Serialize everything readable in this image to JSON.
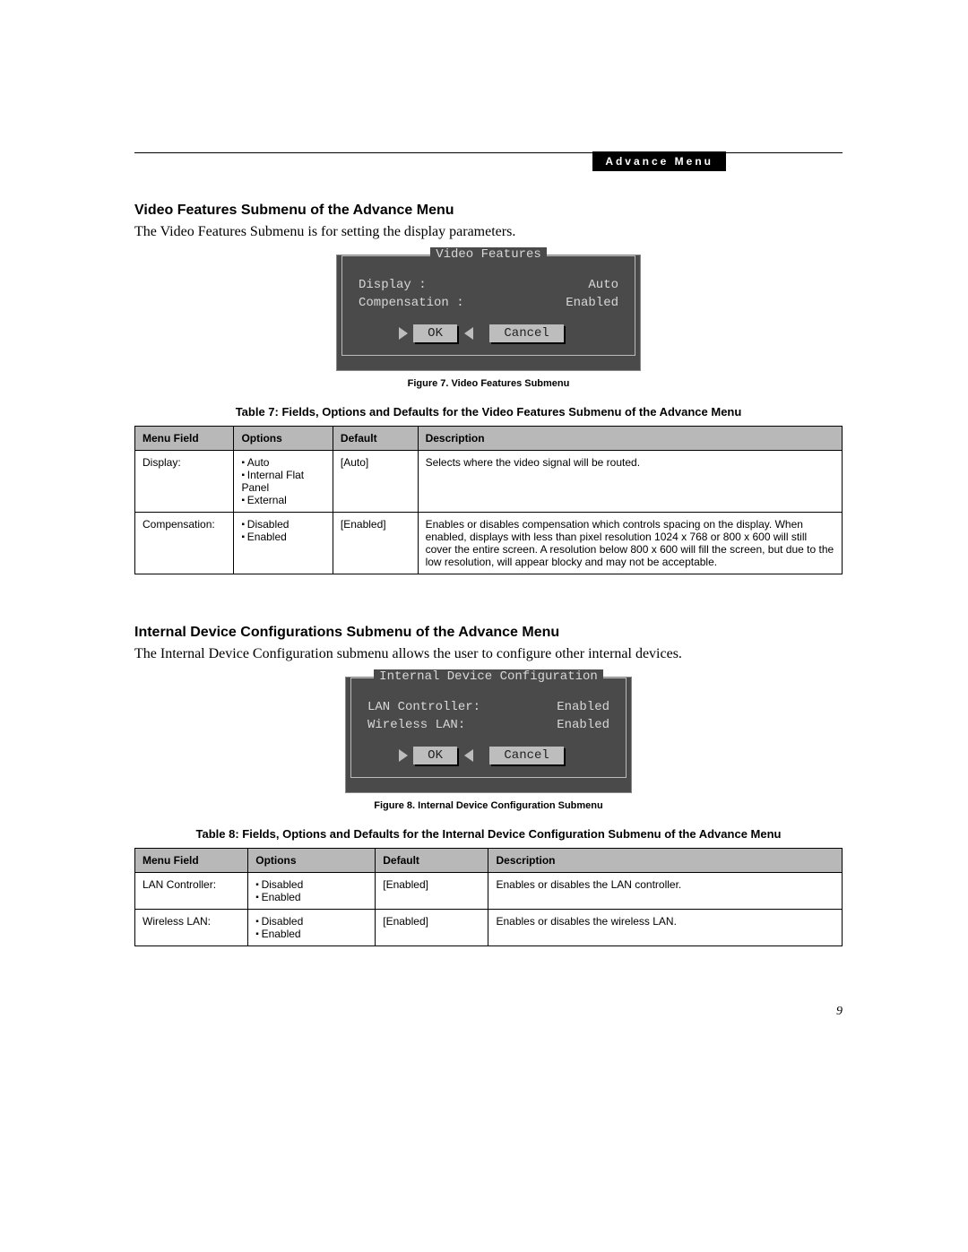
{
  "header": {
    "tag": "Advance Menu"
  },
  "page_number": "9",
  "section1": {
    "heading": "Video Features Submenu of the Advance Menu",
    "intro": "The Video Features Submenu is for setting the display parameters.",
    "panel": {
      "title": "Video Features",
      "rows": [
        {
          "label": "Display :",
          "value": "Auto"
        },
        {
          "label": "Compensation :",
          "value": "Enabled"
        }
      ],
      "buttons": {
        "ok": "OK",
        "cancel": "Cancel"
      }
    },
    "figure_caption": "Figure 7.  Video Features Submenu",
    "table_title": "Table 7: Fields, Options and Defaults for the Video Features Submenu of the Advance Menu",
    "columns": {
      "menu_field": "Menu Field",
      "options": "Options",
      "default": "Default",
      "description": "Description"
    },
    "rows": [
      {
        "menu_field": "Display:",
        "options": [
          "Auto",
          "Internal Flat Panel",
          "External"
        ],
        "default": "[Auto]",
        "description": "Selects where the video signal will be routed."
      },
      {
        "menu_field": "Compensation:",
        "options": [
          "Disabled",
          "Enabled"
        ],
        "default": "[Enabled]",
        "description": "Enables or disables compensation which controls spacing on the display. When enabled, displays with less than pixel resolution 1024 x 768 or 800 x 600 will still cover the entire screen. A resolution below 800 x 600 will fill the screen, but due to the low resolution, will appear blocky and may not be acceptable."
      }
    ]
  },
  "section2": {
    "heading": "Internal Device Configurations Submenu of the Advance Menu",
    "intro": "The Internal Device Configuration submenu allows the user to configure other internal devices.",
    "panel": {
      "title": "Internal Device Configuration",
      "rows": [
        {
          "label": "LAN Controller:",
          "value": "Enabled"
        },
        {
          "label": "Wireless LAN:",
          "value": "Enabled"
        }
      ],
      "buttons": {
        "ok": "OK",
        "cancel": "Cancel"
      }
    },
    "figure_caption": "Figure 8.  Internal Device Configuration Submenu",
    "table_title": "Table 8: Fields, Options and Defaults for the Internal Device Configuration Submenu of the Advance Menu",
    "columns": {
      "menu_field": "Menu Field",
      "options": "Options",
      "default": "Default",
      "description": "Description"
    },
    "rows": [
      {
        "menu_field": "LAN Controller:",
        "options": [
          "Disabled",
          "Enabled"
        ],
        "default": "[Enabled]",
        "description": "Enables or disables the LAN controller."
      },
      {
        "menu_field": "Wireless LAN:",
        "options": [
          "Disabled",
          "Enabled"
        ],
        "default": "[Enabled]",
        "description": "Enables or disables the wireless LAN."
      }
    ]
  }
}
